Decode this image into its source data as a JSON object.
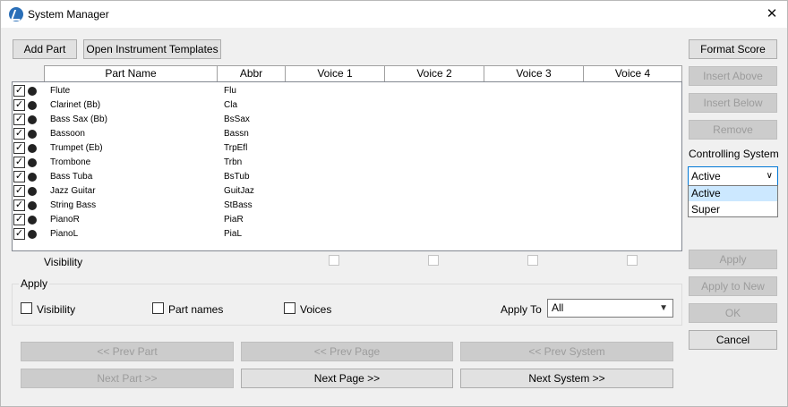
{
  "window": {
    "title": "System Manager"
  },
  "toolbar": {
    "add_part": "Add Part",
    "open_templates": "Open Instrument Templates"
  },
  "grid": {
    "columns": [
      "Part Name",
      "Abbr",
      "Voice 1",
      "Voice 2",
      "Voice 3",
      "Voice 4"
    ],
    "rows": [
      {
        "name": "Flute",
        "abbr": "Flu",
        "checked": true
      },
      {
        "name": "Clarinet (Bb)",
        "abbr": "Cla",
        "checked": true
      },
      {
        "name": "Bass Sax (Bb)",
        "abbr": "BsSax",
        "checked": true
      },
      {
        "name": "Bassoon",
        "abbr": "Bassn",
        "checked": true
      },
      {
        "name": "Trumpet (Eb)",
        "abbr": "TrpEfl",
        "checked": true
      },
      {
        "name": "Trombone",
        "abbr": "Trbn",
        "checked": true
      },
      {
        "name": "Bass Tuba",
        "abbr": "BsTub",
        "checked": true
      },
      {
        "name": "Jazz Guitar",
        "abbr": "GuitJaz",
        "checked": true
      },
      {
        "name": "String Bass",
        "abbr": "StBass",
        "checked": true
      },
      {
        "name": "PianoR",
        "abbr": "PiaR",
        "checked": true
      },
      {
        "name": "PianoL",
        "abbr": "PiaL",
        "checked": true
      }
    ],
    "visibility_label": "Visibility"
  },
  "side": {
    "format_score": "Format Score",
    "insert_above": "Insert Above",
    "insert_below": "Insert Below",
    "remove": "Remove",
    "controlling_system_label": "Controlling System",
    "controlling_system_value": "Active",
    "controlling_system_options": [
      "Active",
      "Super"
    ],
    "apply": "Apply",
    "apply_to_new": "Apply to New",
    "ok": "OK",
    "cancel": "Cancel"
  },
  "apply_group": {
    "legend": "Apply",
    "visibility": "Visibility",
    "part_names": "Part names",
    "voices": "Voices",
    "apply_to_label": "Apply To",
    "apply_to_value": "All"
  },
  "nav": {
    "prev_part": "<< Prev Part",
    "prev_page": "<< Prev Page",
    "prev_system": "<< Prev System",
    "next_part": "Next Part >>",
    "next_page": "Next Page >>",
    "next_system": "Next System >>"
  }
}
